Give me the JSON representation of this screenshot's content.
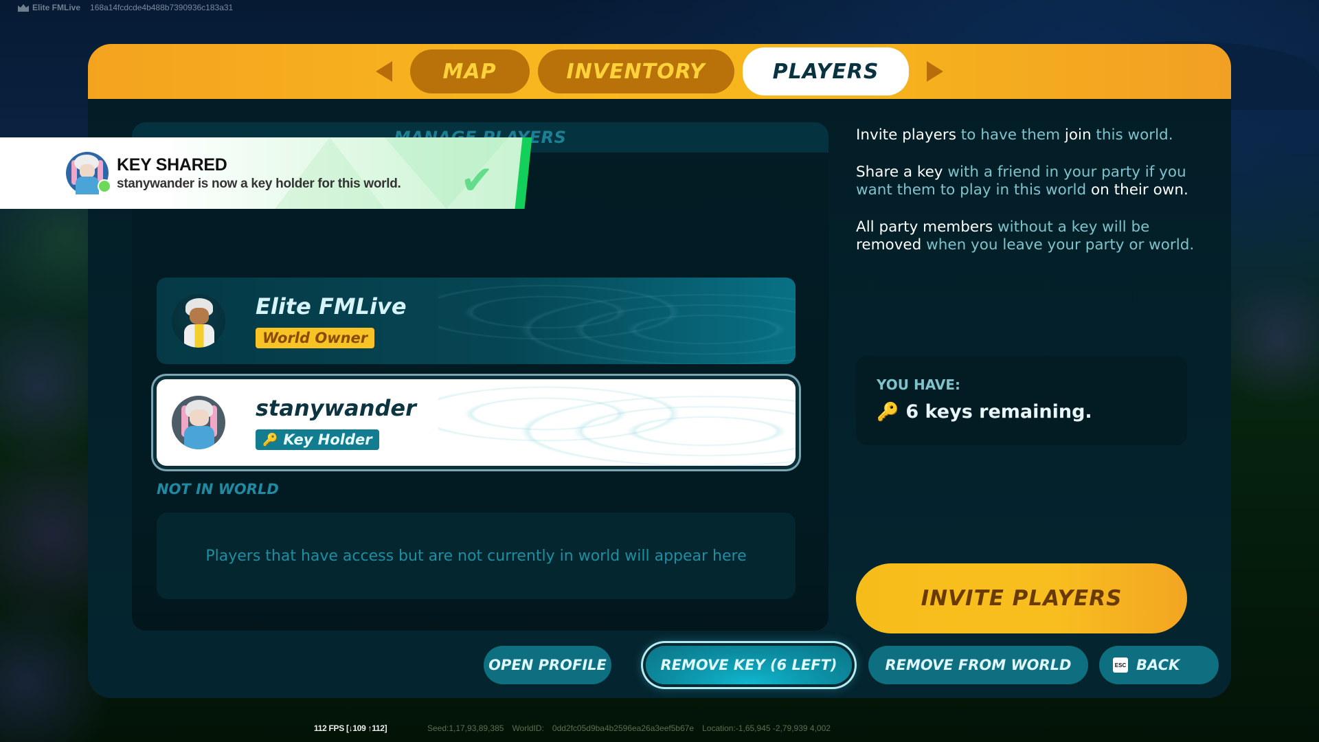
{
  "top_overlay": {
    "icon": "crown-icon",
    "user": "Elite FMLive",
    "session_id": "168a14fcdcde4b488b7390936c183a31"
  },
  "tabs": [
    {
      "label": "MAP",
      "active": false
    },
    {
      "label": "INVENTORY",
      "active": false
    },
    {
      "label": "PLAYERS",
      "active": true
    }
  ],
  "tab_nav": {
    "prev_icon": "triangle-left-icon",
    "next_icon": "triangle-right-icon"
  },
  "manage": {
    "title": "MANAGE PLAYERS",
    "players": [
      {
        "name": "Elite FMLive",
        "role": "World Owner",
        "selected": false
      },
      {
        "name": "stanywander",
        "role": "Key Holder",
        "role_icon": "key-icon",
        "selected": true
      }
    ],
    "not_in_world_label": "NOT IN WORLD",
    "not_in_world_empty": "Players that have access but are not currently in world will appear here"
  },
  "info": {
    "p1": [
      {
        "text": "Invite players",
        "highlight": true
      },
      {
        "text": " to have them ",
        "highlight": false
      },
      {
        "text": "join",
        "highlight": true
      },
      {
        "text": " this world.",
        "highlight": false
      }
    ],
    "p2": [
      {
        "text": "Share a key",
        "highlight": true
      },
      {
        "text": " with a friend in your party if you want them to play in this world ",
        "highlight": false
      },
      {
        "text": "on their own.",
        "highlight": true
      }
    ],
    "p3": [
      {
        "text": "All party members",
        "highlight": true
      },
      {
        "text": " without a key will be ",
        "highlight": false
      },
      {
        "text": "removed",
        "highlight": true
      },
      {
        "text": " when you leave your party or world.",
        "highlight": false
      }
    ]
  },
  "keys": {
    "label": "YOU HAVE:",
    "icon": "key-icon",
    "remaining_text": "6 keys remaining.",
    "remaining_count": 6
  },
  "invite_button": "INVITE PLAYERS",
  "actions": {
    "open_profile": "OPEN PROFILE",
    "remove_key": "REMOVE KEY (6 LEFT)",
    "remove_from_world": "REMOVE FROM WORLD",
    "back": "BACK",
    "back_key": "ESC"
  },
  "toast": {
    "title": "KEY SHARED",
    "message": "stanywander is now a key holder for this world.",
    "icon": "checkmark-icon"
  },
  "bottom_overlay": {
    "fps": "112 FPS [↓109 ↑112]",
    "seed": "Seed:1,17,93,89,385",
    "world_id_label": "WorldID:",
    "world_id": "0dd2fc05d9ba4b2596ea26a3eef5b67e",
    "location": "Location:-1,65,945 -2,79,939 4,002"
  },
  "colors": {
    "accent_yellow": "#f8be1f",
    "panel_bg": "#042b34",
    "teal_button": "#0d6f80",
    "toast_green": "#13d05a"
  }
}
